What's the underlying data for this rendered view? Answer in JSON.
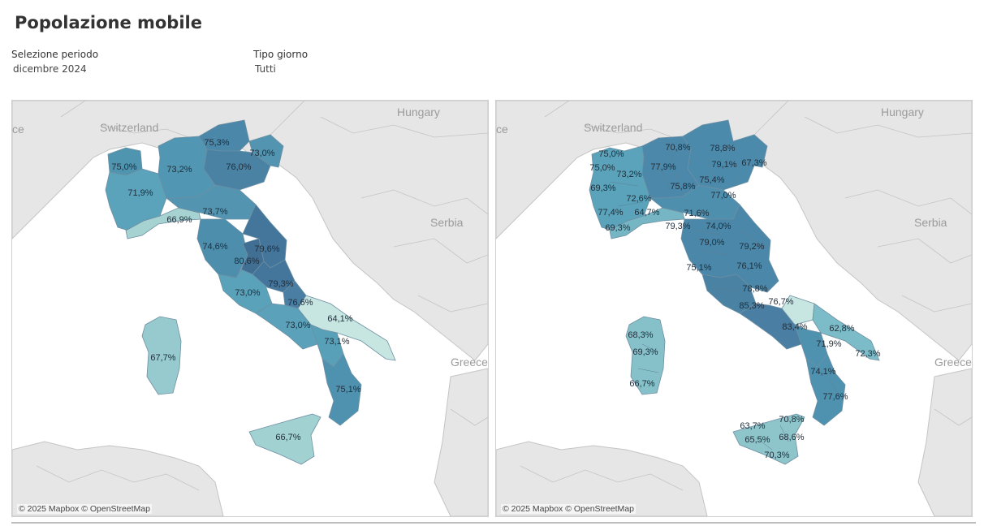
{
  "page": {
    "title": "Popolazione mobile"
  },
  "filters": {
    "period": {
      "label": "Selezione periodo",
      "value": "dicembre 2024"
    },
    "daytype": {
      "label": "Tipo giorno",
      "value": "Tutti"
    }
  },
  "attribution": "© 2025 Mapbox © OpenStreetMap",
  "colors": {
    "sea": "#ffffff",
    "land": "#e6e6e6",
    "border": "#bfbfbf",
    "scale_low": "#c9e6e1",
    "scale_high": "#3f6f97"
  },
  "countries": [
    "ce",
    "Switzerland",
    "Hungary",
    "Serbia",
    "Greece"
  ],
  "maps": [
    {
      "name": "regions",
      "labels": [
        "75,3%",
        "73,0%",
        "75,0%",
        "73,2%",
        "76,0%",
        "71,9%",
        "66,9%",
        "73,7%",
        "74,6%",
        "79,6%",
        "80,6%",
        "79,3%",
        "73,0%",
        "76,6%",
        "64,1%",
        "73,0%",
        "73,1%",
        "67,7%",
        "75,1%",
        "66,7%"
      ]
    },
    {
      "name": "provinces",
      "labels": [
        "70,8%",
        "78,8%",
        "75,0%",
        "67,3%",
        "79,1%",
        "75,0%",
        "77,9%",
        "73,2%",
        "75,4%",
        "69,3%",
        "75,8%",
        "77,0%",
        "72,6%",
        "71,6%",
        "77,4%",
        "64,7%",
        "79,3%",
        "74,0%",
        "69,3%",
        "79,0%",
        "79,2%",
        "75,1%",
        "76,1%",
        "78,8%",
        "85,3%",
        "76,7%",
        "83,4%",
        "62,8%",
        "68,3%",
        "71,9%",
        "69,3%",
        "72,3%",
        "66,7%",
        "74,1%",
        "77,6%",
        "70,8%",
        "63,7%",
        "68,6%",
        "65,5%",
        "70,3%"
      ]
    }
  ]
}
